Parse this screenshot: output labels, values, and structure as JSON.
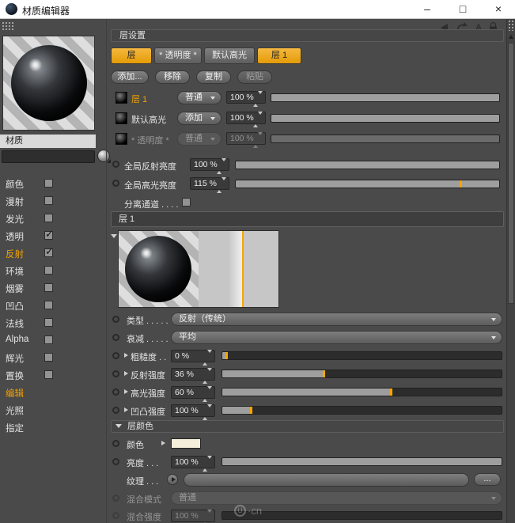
{
  "window": {
    "title": "材质编辑器",
    "minimize": "–",
    "maximize": "□",
    "close": "×"
  },
  "colors": {
    "accent": "#f7a600",
    "active_tab": "#e9a21c"
  },
  "left": {
    "material_label": "材质",
    "name_value": "",
    "channels": [
      {
        "label": "颜色",
        "check": ""
      },
      {
        "label": "漫射",
        "check": ""
      },
      {
        "label": "发光",
        "check": ""
      },
      {
        "label": "透明",
        "check": "✓"
      },
      {
        "label": "反射",
        "check": "✓"
      },
      {
        "label": "环境",
        "check": ""
      },
      {
        "label": "烟雾",
        "check": ""
      },
      {
        "label": "凹凸",
        "check": ""
      },
      {
        "label": "法线",
        "check": ""
      },
      {
        "label": "Alpha",
        "check": ""
      },
      {
        "label": "辉光",
        "check": ""
      },
      {
        "label": "置换",
        "check": ""
      },
      {
        "label": "编辑"
      },
      {
        "label": "光照"
      },
      {
        "label": "指定"
      }
    ]
  },
  "icons": {
    "a_label": "A"
  },
  "main": {
    "section_header": "层设置",
    "tabs": [
      {
        "label": "层"
      },
      {
        "label": "* 透明度 *"
      },
      {
        "label": "默认高光"
      },
      {
        "label": "层 1"
      }
    ],
    "actions": {
      "add": "添加...",
      "remove": "移除",
      "copy": "复制",
      "paste": "粘贴"
    },
    "layers": [
      {
        "name": "层 1",
        "mode": "普通",
        "value": "100 %",
        "fill": 100
      },
      {
        "name": "默认高光",
        "mode": "添加",
        "value": "100 %",
        "fill": 100
      },
      {
        "name": "* 透明度 *",
        "mode": "普通",
        "value": "100 %",
        "fill": 100
      }
    ],
    "globals": [
      {
        "label": "全局反射亮度",
        "value": "100 %",
        "fill": 100
      },
      {
        "label": "全局高光亮度",
        "value": "115 %",
        "fill": 100,
        "tick": 85
      }
    ],
    "separate_label": "分离通道 . . . .",
    "layer_header": "层 1",
    "params": {
      "type": {
        "label": "类型 . . . . .",
        "value": "反射（传统）"
      },
      "falloff": {
        "label": "衰减 . . . . .",
        "value": "平均"
      },
      "roughness": {
        "label": "粗糙度 . .",
        "value": "0 %",
        "fill": 1
      },
      "reflection": {
        "label": "反射强度",
        "value": "36 %",
        "fill": 36
      },
      "specular": {
        "label": "高光强度",
        "value": "60 %",
        "fill": 60
      },
      "bump": {
        "label": "凹凸强度",
        "value": "100 %",
        "fill": 10
      }
    },
    "layer_color": {
      "header": "层颜色",
      "color_label": "颜色",
      "swatch": "#f4eedb",
      "brightness": {
        "label": "亮度 . . .",
        "value": "100 %",
        "fill": 100
      },
      "texture": {
        "label": "纹理 . . .",
        "more": "..."
      },
      "mix_mode": {
        "label": "混合模式",
        "value": "普通"
      },
      "mix_strength": {
        "label": "混合强度",
        "value": "100 %"
      }
    }
  },
  "watermark": {
    "letter": "U",
    "suffix": "·cn"
  }
}
